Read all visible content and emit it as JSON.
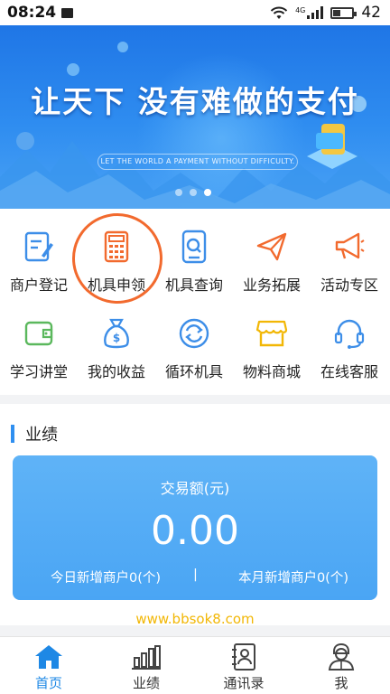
{
  "status_bar": {
    "time": "08:24",
    "sd_icon": "sd-card-icon",
    "network_label": "4G",
    "battery": "42",
    "battery_level": 0.42
  },
  "banner": {
    "title": "让天下 没有难做的支付",
    "subtitle": "LET THE WORLD A PAYMENT WITHOUT DIFFICULTY.",
    "slide_count": 3,
    "active_slide": 3
  },
  "menu": {
    "items": [
      {
        "label": "商户登记",
        "icon": "register-icon"
      },
      {
        "label": "机具申领",
        "icon": "calculator-icon"
      },
      {
        "label": "机具查询",
        "icon": "device-search-icon"
      },
      {
        "label": "业务拓展",
        "icon": "paper-plane-icon"
      },
      {
        "label": "活动专区",
        "icon": "megaphone-icon"
      },
      {
        "label": "学习讲堂",
        "icon": "wallet-icon"
      },
      {
        "label": "我的收益",
        "icon": "money-bag-icon"
      },
      {
        "label": "循环机具",
        "icon": "cycle-icon"
      },
      {
        "label": "物料商城",
        "icon": "store-icon"
      },
      {
        "label": "在线客服",
        "icon": "headset-icon"
      }
    ]
  },
  "performance": {
    "title": "业绩",
    "card": {
      "label": "交易额(元)",
      "value": "0.00",
      "today_new": "今日新增商户0(个)",
      "separator": "|",
      "month_new": "本月新增商户0(个)"
    }
  },
  "watermark": "www.bbsok8.com",
  "bottom_nav": {
    "tabs": [
      {
        "label": "首页",
        "icon": "home-icon",
        "active": true
      },
      {
        "label": "业绩",
        "icon": "bar-chart-icon",
        "active": false
      },
      {
        "label": "通讯录",
        "icon": "contacts-icon",
        "active": false
      },
      {
        "label": "我",
        "icon": "user-icon",
        "active": false
      }
    ]
  },
  "colors": {
    "accent": "#2f8ff0",
    "active_tab": "#1e88e5",
    "highlight_circle": "#f26a2e",
    "watermark": "#f2b705"
  }
}
